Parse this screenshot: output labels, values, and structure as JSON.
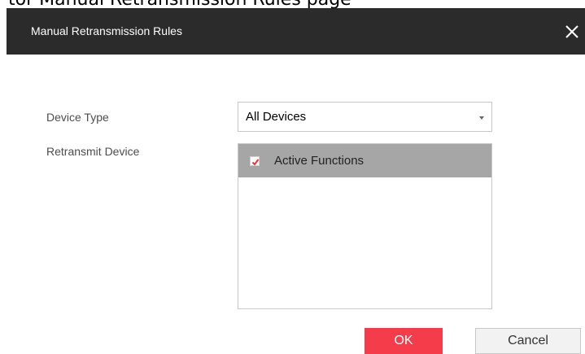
{
  "page_caption": "tor Manual Retransmission Rules page",
  "dialog": {
    "title": "Manual Retransmission Rules",
    "close_icon": "close-icon"
  },
  "form": {
    "device_type_label": "Device Type",
    "device_type_value": "All Devices",
    "retransmit_device_label": "Retransmit Device",
    "retransmit_items": [
      {
        "label": "Active Functions",
        "checked": true
      }
    ]
  },
  "buttons": {
    "ok_label": "OK",
    "cancel_label": "Cancel"
  },
  "colors": {
    "titlebar_bg": "#2b2b2b",
    "ok_bg": "#f53c4a",
    "selected_row_bg": "#a6a6a6",
    "check_mark": "#e8323c"
  }
}
